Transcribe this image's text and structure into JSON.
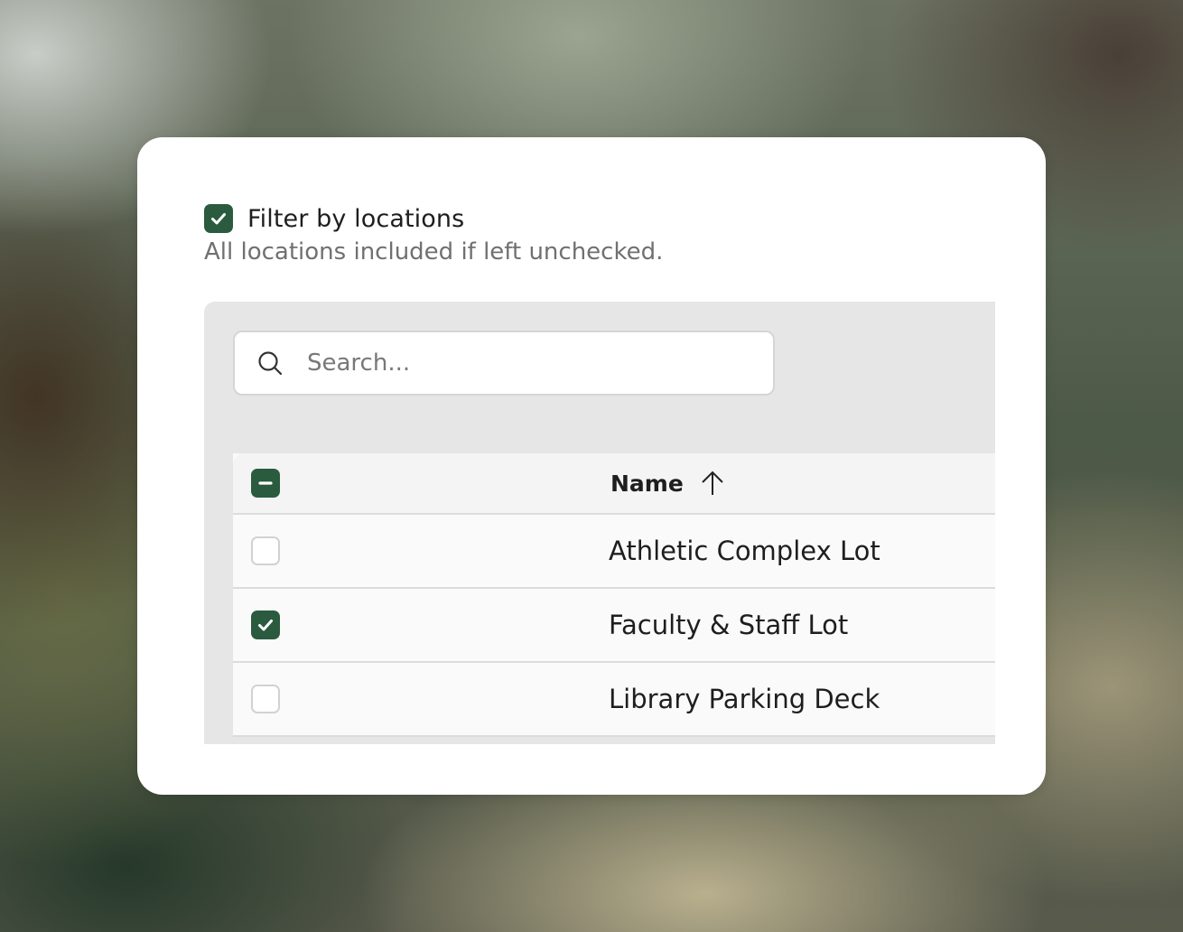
{
  "filter": {
    "checked": true,
    "label": "Filter by locations",
    "help_text": "All locations included if left unchecked."
  },
  "search": {
    "icon": "search-icon",
    "placeholder": "Search...",
    "value": ""
  },
  "table": {
    "select_all_state": "indeterminate",
    "columns": [
      {
        "label": "Name",
        "sort": "ascending",
        "sort_icon": "arrow-up-icon"
      }
    ],
    "rows": [
      {
        "name": "Athletic Complex Lot",
        "checked": false
      },
      {
        "name": "Faculty & Staff Lot",
        "checked": true
      },
      {
        "name": "Library Parking Deck",
        "checked": false
      }
    ]
  },
  "colors": {
    "accent": "#2b5b3f",
    "panel_bg": "#e6e6e6",
    "help_text": "#707070"
  }
}
